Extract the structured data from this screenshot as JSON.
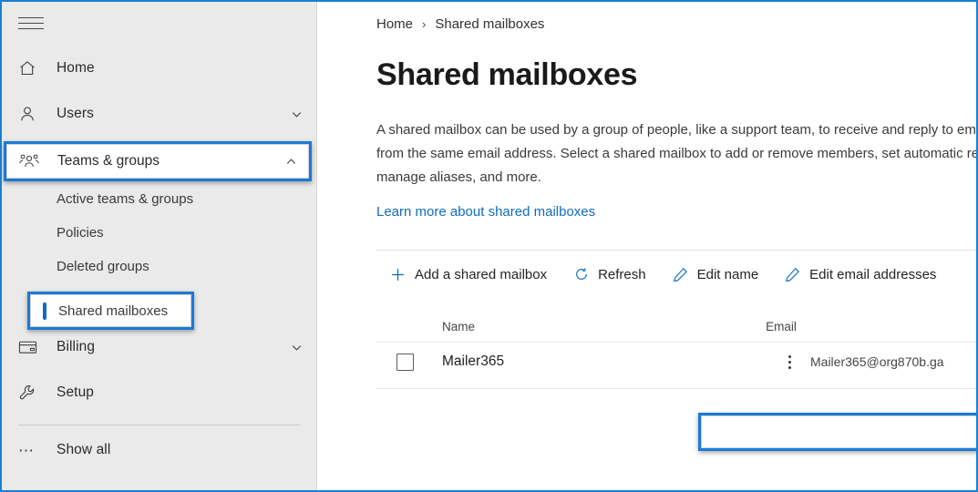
{
  "sidebar": {
    "menu_icon": "hamburger-icon",
    "items": [
      {
        "label": "Home",
        "icon": "home-icon",
        "chevron": ""
      },
      {
        "label": "Users",
        "icon": "person-icon",
        "chevron": "chevron-down-icon"
      },
      {
        "label": "Teams & groups",
        "icon": "people-group-icon",
        "chevron": "chevron-up-icon"
      },
      {
        "label": "Billing",
        "icon": "credit-card-icon",
        "chevron": "chevron-down-icon"
      },
      {
        "label": "Setup",
        "icon": "wrench-icon",
        "chevron": ""
      },
      {
        "label": "Show all",
        "icon": "ellipsis-icon",
        "chevron": ""
      }
    ],
    "sub_items": [
      {
        "label": "Active teams & groups",
        "selected": false
      },
      {
        "label": "Policies",
        "selected": false
      },
      {
        "label": "Deleted groups",
        "selected": false
      },
      {
        "label": "Shared mailboxes",
        "selected": true
      }
    ]
  },
  "breadcrumb": {
    "home": "Home",
    "separator": "›",
    "current": "Shared mailboxes"
  },
  "main": {
    "title": "Shared mailboxes",
    "description": "A shared mailbox can be used by a group of people, like a support team, to receive and reply to email from the same email address. Select a shared mailbox to add or remove members, set automatic replies, manage aliases, and more.",
    "learn_more": "Learn more about shared mailboxes"
  },
  "toolbar": {
    "commands": [
      {
        "label": "Add a shared mailbox",
        "icon": "plus-icon"
      },
      {
        "label": "Refresh",
        "icon": "refresh-icon"
      },
      {
        "label": "Edit name",
        "icon": "pencil-icon"
      },
      {
        "label": "Edit email addresses",
        "icon": "pencil-icon"
      }
    ]
  },
  "table": {
    "columns": [
      "Name",
      "Email"
    ],
    "rows": [
      {
        "name": "Mailer365",
        "email": "Mailer365@org870b.ga",
        "checked": false,
        "overflow": "more-options-icon"
      }
    ]
  },
  "colors": {
    "accent": "#0f6cbd",
    "highlight_border": "#1b7ad6",
    "sidebar_bg": "#eaeaea",
    "window_border": "#1a7fd4"
  }
}
